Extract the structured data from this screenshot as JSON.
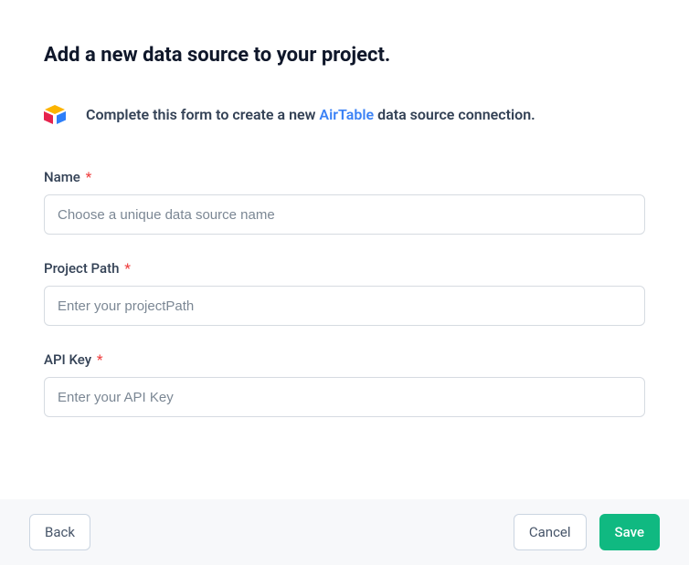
{
  "title": "Add a new data source to your project.",
  "intro": {
    "prefix": "Complete this form to create a new ",
    "link": "AirTable",
    "suffix": " data source connection."
  },
  "fields": {
    "name": {
      "label": "Name",
      "placeholder": "Choose a unique data source name",
      "value": ""
    },
    "project_path": {
      "label": "Project Path",
      "placeholder": "Enter your projectPath",
      "value": ""
    },
    "api_key": {
      "label": "API Key",
      "placeholder": "Enter your API Key",
      "value": ""
    }
  },
  "buttons": {
    "back": "Back",
    "cancel": "Cancel",
    "save": "Save"
  },
  "required_marker": "*"
}
